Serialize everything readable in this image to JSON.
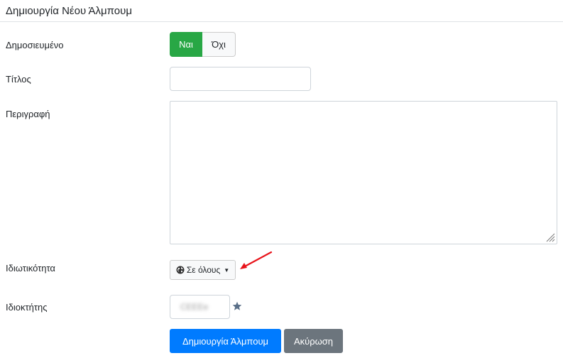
{
  "form": {
    "title": "Δημιουργία Νέου Άλμπουμ"
  },
  "fields": {
    "published": {
      "label": "Δημοσιευμένο",
      "yes_label": "Ναι",
      "no_label": "Όχι",
      "selected": "Ναι"
    },
    "title": {
      "label": "Τίτλος",
      "value": ""
    },
    "description": {
      "label": "Περιγραφή",
      "value": ""
    },
    "privacy": {
      "label": "Ιδιωτικότητα",
      "selected": "Σε όλους",
      "icon": "globe-icon"
    },
    "owner": {
      "label": "Ιδιοκτήτης",
      "value": "CEEEe",
      "icon": "star-icon"
    }
  },
  "actions": {
    "create_label": "Δημιουργία Άλμπουμ",
    "cancel_label": "Ακύρωση"
  },
  "colors": {
    "success": "#28a745",
    "primary": "#007bff",
    "secondary": "#6c757d",
    "annotation_arrow": "#e8141b",
    "star": "#5a6f88"
  }
}
